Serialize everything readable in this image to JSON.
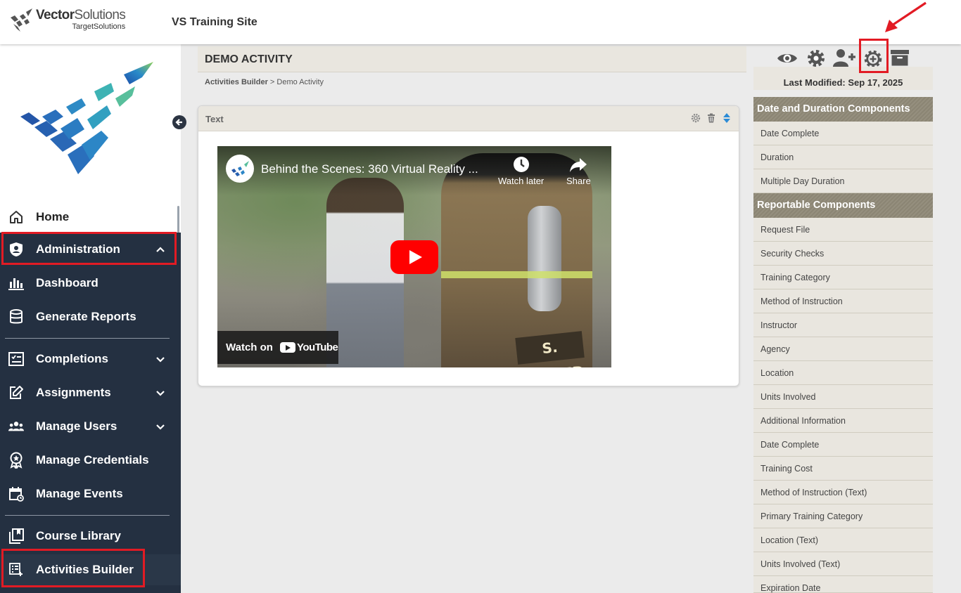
{
  "header": {
    "brand_name_bold": "Vector",
    "brand_name_light": "Solutions",
    "brand_sub": "TargetSolutions",
    "site_name": "VS Training Site"
  },
  "sidebar": {
    "collapse_icon": "arrow-left-icon",
    "home": {
      "label": "Home",
      "icon": "home-icon"
    },
    "items": [
      {
        "label": "Administration",
        "icon": "shield-user-icon",
        "chevron": "chevron-up"
      },
      {
        "label": "Dashboard",
        "icon": "bar-chart-icon"
      },
      {
        "label": "Generate Reports",
        "icon": "database-icon"
      },
      {
        "label": "Completions",
        "icon": "checklist-icon",
        "chevron": "chevron-down"
      },
      {
        "label": "Assignments",
        "icon": "edit-icon",
        "chevron": "chevron-down"
      },
      {
        "label": "Manage Users",
        "icon": "users-icon",
        "chevron": "chevron-down"
      },
      {
        "label": "Manage Credentials",
        "icon": "award-icon"
      },
      {
        "label": "Manage Events",
        "icon": "calendar-icon"
      },
      {
        "label": "Course Library",
        "icon": "library-icon"
      },
      {
        "label": "Activities Builder",
        "icon": "activities-icon"
      }
    ]
  },
  "main": {
    "page_title": "DEMO ACTIVITY",
    "breadcrumb": {
      "link": "Activities Builder",
      "separator": ">",
      "current": "Demo Activity"
    },
    "card": {
      "title": "Text",
      "video": {
        "title": "Behind the Scenes: 360 Virtual Reality ...",
        "watch_later": "Watch later",
        "share": "Share",
        "watch_on": "Watch on",
        "youtube": "YouTube",
        "name_patch": "S. WHITED"
      }
    }
  },
  "right_panel": {
    "toolbar_icons": [
      "eye-icon",
      "gear-icon",
      "add-user-icon",
      "add-component-gear-icon",
      "archive-icon"
    ],
    "last_modified": "Last Modified: Sep 17, 2025",
    "sections": [
      {
        "title": "Date and Duration Components",
        "items": [
          "Date Complete",
          "Duration",
          "Multiple Day Duration"
        ]
      },
      {
        "title": "Reportable Components",
        "items": [
          "Request File",
          "Security Checks",
          "Training Category",
          "Method of Instruction",
          "Instructor",
          "Agency",
          "Location",
          "Units Involved",
          "Additional Information",
          "Date Complete",
          "Training Cost",
          "Method of Instruction (Text)",
          "Primary Training Category",
          "Location (Text)",
          "Units Involved (Text)",
          "Expiration Date"
        ]
      }
    ]
  },
  "colors": {
    "sidebar_dark": "#243041",
    "highlight": "#e21b24",
    "panel_header": "#8b8574",
    "panel_item": "#e9e6df"
  }
}
